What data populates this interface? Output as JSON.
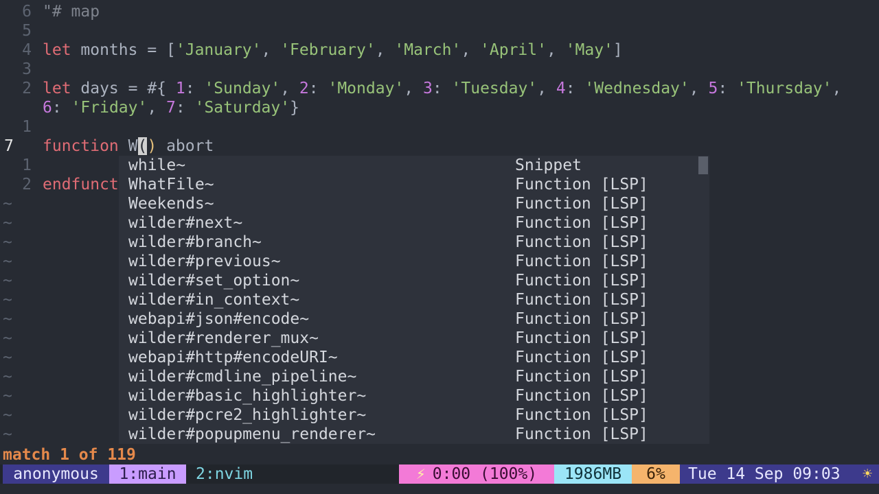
{
  "editor": {
    "lines": [
      {
        "num": "6",
        "parts": [
          {
            "t": "\"# map",
            "c": "comment"
          }
        ]
      },
      {
        "num": "5",
        "parts": []
      },
      {
        "num": "4",
        "parts": [
          {
            "t": "let",
            "c": "kw"
          },
          {
            "t": " months = [",
            "c": "id"
          },
          {
            "t": "'January'",
            "c": "str"
          },
          {
            "t": ", ",
            "c": "id"
          },
          {
            "t": "'February'",
            "c": "str"
          },
          {
            "t": ", ",
            "c": "id"
          },
          {
            "t": "'March'",
            "c": "str"
          },
          {
            "t": ", ",
            "c": "id"
          },
          {
            "t": "'April'",
            "c": "str"
          },
          {
            "t": ", ",
            "c": "id"
          },
          {
            "t": "'May'",
            "c": "str"
          },
          {
            "t": "]",
            "c": "id"
          }
        ]
      },
      {
        "num": "3",
        "parts": []
      },
      {
        "num": "2",
        "parts": [
          {
            "t": "let",
            "c": "kw"
          },
          {
            "t": " days = #{ ",
            "c": "id"
          },
          {
            "t": "1",
            "c": "num"
          },
          {
            "t": ": ",
            "c": "id"
          },
          {
            "t": "'Sunday'",
            "c": "str"
          },
          {
            "t": ", ",
            "c": "id"
          },
          {
            "t": "2",
            "c": "num"
          },
          {
            "t": ": ",
            "c": "id"
          },
          {
            "t": "'Monday'",
            "c": "str"
          },
          {
            "t": ", ",
            "c": "id"
          },
          {
            "t": "3",
            "c": "num"
          },
          {
            "t": ": ",
            "c": "id"
          },
          {
            "t": "'Tuesday'",
            "c": "str"
          },
          {
            "t": ", ",
            "c": "id"
          },
          {
            "t": "4",
            "c": "num"
          },
          {
            "t": ": ",
            "c": "id"
          },
          {
            "t": "'Wednesday'",
            "c": "str"
          },
          {
            "t": ", ",
            "c": "id"
          },
          {
            "t": "5",
            "c": "num"
          },
          {
            "t": ": ",
            "c": "id"
          },
          {
            "t": "'Thursday'",
            "c": "str"
          },
          {
            "t": ",",
            "c": "id"
          }
        ]
      },
      {
        "num": "",
        "parts": [
          {
            "t": "6",
            "c": "num"
          },
          {
            "t": ": ",
            "c": "id"
          },
          {
            "t": "'Friday'",
            "c": "str"
          },
          {
            "t": ", ",
            "c": "id"
          },
          {
            "t": "7",
            "c": "num"
          },
          {
            "t": ": ",
            "c": "id"
          },
          {
            "t": "'Saturday'",
            "c": "str"
          },
          {
            "t": "}",
            "c": "id"
          }
        ]
      },
      {
        "num": "1",
        "parts": []
      },
      {
        "num": "7",
        "current": true,
        "parts": [
          {
            "t": "function",
            "c": "kw"
          },
          {
            "t": " ",
            "c": "id"
          },
          {
            "t": "W",
            "c": "id"
          },
          {
            "t": "(",
            "c": "cursor"
          },
          {
            "t": ")",
            "c": "paren"
          },
          {
            "t": " abort",
            "c": "id"
          }
        ]
      },
      {
        "num": "1",
        "parts": []
      },
      {
        "num": "2",
        "parts": [
          {
            "t": "endfunct",
            "c": "kw"
          }
        ]
      }
    ],
    "tilde_count": 13,
    "tilde_char": "~"
  },
  "completion": {
    "items": [
      {
        "word": "while~",
        "kind": "Snippet"
      },
      {
        "word": "WhatFile~",
        "kind": "Function [LSP]"
      },
      {
        "word": "Weekends~",
        "kind": "Function [LSP]"
      },
      {
        "word": "wilder#next~",
        "kind": "Function [LSP]"
      },
      {
        "word": "wilder#branch~",
        "kind": "Function [LSP]"
      },
      {
        "word": "wilder#previous~",
        "kind": "Function [LSP]"
      },
      {
        "word": "wilder#set_option~",
        "kind": "Function [LSP]"
      },
      {
        "word": "wilder#in_context~",
        "kind": "Function [LSP]"
      },
      {
        "word": "webapi#json#encode~",
        "kind": "Function [LSP]"
      },
      {
        "word": "wilder#renderer_mux~",
        "kind": "Function [LSP]"
      },
      {
        "word": "webapi#http#encodeURI~",
        "kind": "Function [LSP]"
      },
      {
        "word": "wilder#cmdline_pipeline~",
        "kind": "Function [LSP]"
      },
      {
        "word": "wilder#basic_highlighter~",
        "kind": "Function [LSP]"
      },
      {
        "word": "wilder#pcre2_highlighter~",
        "kind": "Function [LSP]"
      },
      {
        "word": "wilder#popupmenu_renderer~",
        "kind": "Function [LSP]"
      }
    ]
  },
  "message": "match 1 of 119",
  "statusbar": {
    "session": "anonymous",
    "window1": "1:main",
    "window2": "2:nvim",
    "battery_icon": "⚡",
    "battery": "0:00 (100%)",
    "memory": "1986MB",
    "cpu": "6%",
    "datetime": "Tue 14 Sep 09:03",
    "weather_icon": "☀"
  }
}
